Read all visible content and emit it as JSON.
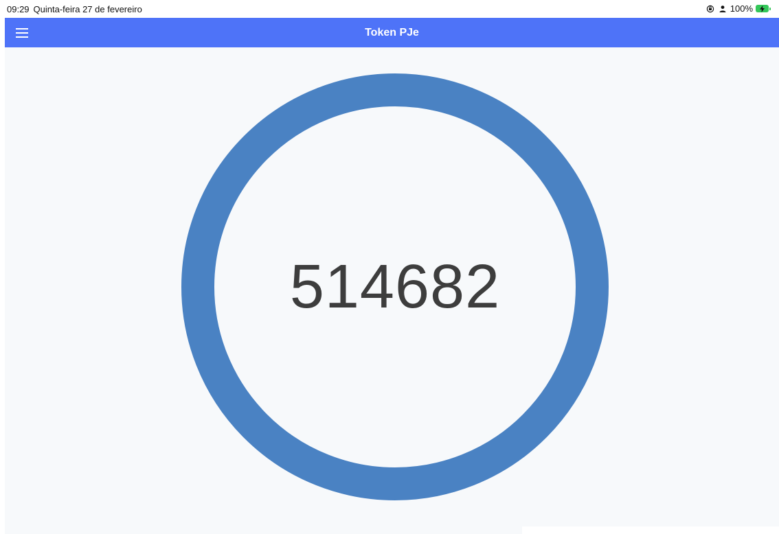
{
  "status_bar": {
    "time": "09:29",
    "date": "Quinta-feira 27 de fevereiro",
    "battery_percent": "100%",
    "icons": [
      "orientation-lock-icon",
      "person-icon",
      "battery-charging-icon"
    ]
  },
  "app_bar": {
    "title": "Token PJe",
    "menu_icon": "hamburger-menu-icon"
  },
  "token": {
    "value": "514682",
    "ring_color": "#4a82c3"
  },
  "colors": {
    "app_bar": "#4e73f8",
    "background": "#f7f9fb",
    "token_text": "#3d3d3d",
    "battery": "#34c759"
  }
}
